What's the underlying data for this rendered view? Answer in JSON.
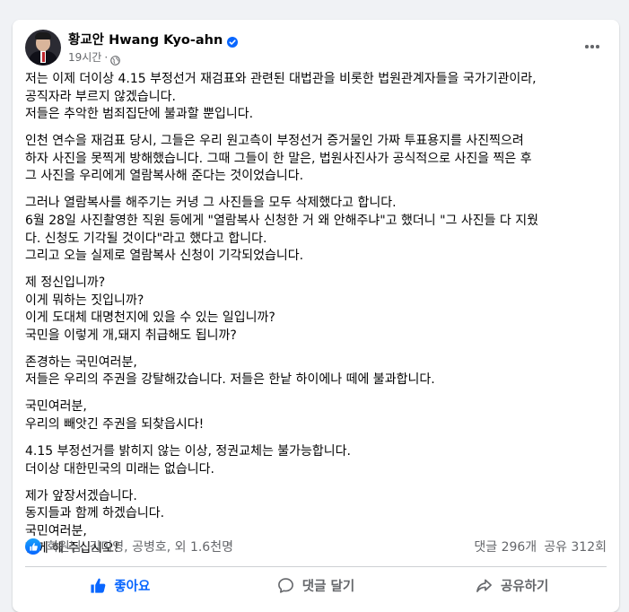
{
  "post": {
    "author": "황교안 Hwang Kyo-ahn",
    "timestamp": "19시간",
    "dot": "·",
    "paragraphs": [
      {
        "lines": [
          "저는 이제 더이상 4.15 부정선거 재검표와 관련된 대법관을 비롯한 법원관계자들을 국가기관이라,",
          "공직자라 부르지 않겠습니다.",
          "저들은 추악한 범죄집단에 불과할 뿐입니다."
        ]
      },
      {
        "lines": [
          "인천 연수을 재검표 당시, 그들은 우리 원고측이 부정선거 증거물인 가짜 투표용지를 사진찍으려",
          "하자 사진을 못찍게 방해했습니다. 그때 그들이 한 말은, 법원사진사가 공식적으로 사진을 찍은 후",
          "그 사진을 우리에게 열람복사해 준다는 것이었습니다."
        ]
      },
      {
        "lines": [
          "그러나 열람복사를 해주기는 커녕 그 사진들을 모두 삭제했다고 합니다.",
          "6월 28일 사진촬영한 직원 등에게 \"열람복사 신청한 거 왜 안해주냐\"고 했더니 \"그 사진들 다 지웠",
          "다. 신청도 기각될 것이다\"라고 했다고 합니다.",
          "그리고 오늘 실제로 열람복사 신청이 기각되었습니다."
        ]
      },
      {
        "lines": [
          "제 정신입니까?",
          "이게 뭐하는 짓입니까?",
          "이게 도대체 대명천지에 있을 수 있는 일입니까?",
          "국민을 이렇게 개,돼지 취급해도 됩니까?"
        ]
      },
      {
        "lines": [
          "존경하는 국민여러분,",
          "저들은 우리의 주권을 강탈해갔습니다. 저들은 한낱 하이에나 떼에 불과합니다."
        ]
      },
      {
        "lines": [
          "국민여러분,",
          "우리의 빼앗긴 주권을 되찾읍시다!"
        ]
      },
      {
        "lines": [
          "4.15 부정선거를 밝히지 않는 이상, 정권교체는 불가능합니다.",
          "더이상 대한민국의 미래는 없습니다."
        ]
      },
      {
        "lines": [
          "제가 앞장서겠습니다.",
          "동지들과 함께 하겠습니다.",
          "국민여러분,",
          "함께 해 주십시오!"
        ]
      }
    ]
  },
  "reactions": {
    "names": "회원님, 김미영, 공병호, 외 1.6천명",
    "comments": "댓글 296개",
    "shares": "공유 312회"
  },
  "actions": {
    "like": "좋아요",
    "comment": "댓글 달기",
    "share": "공유하기"
  },
  "colors": {
    "accent": "#0866ff",
    "secondary_text": "#65676b",
    "background": "#f0f2f5"
  },
  "icons": [
    "verified-badge-icon",
    "globe-icon",
    "more-options-icon",
    "like-reaction-icon",
    "thumbs-up-icon",
    "comment-icon",
    "share-icon"
  ]
}
